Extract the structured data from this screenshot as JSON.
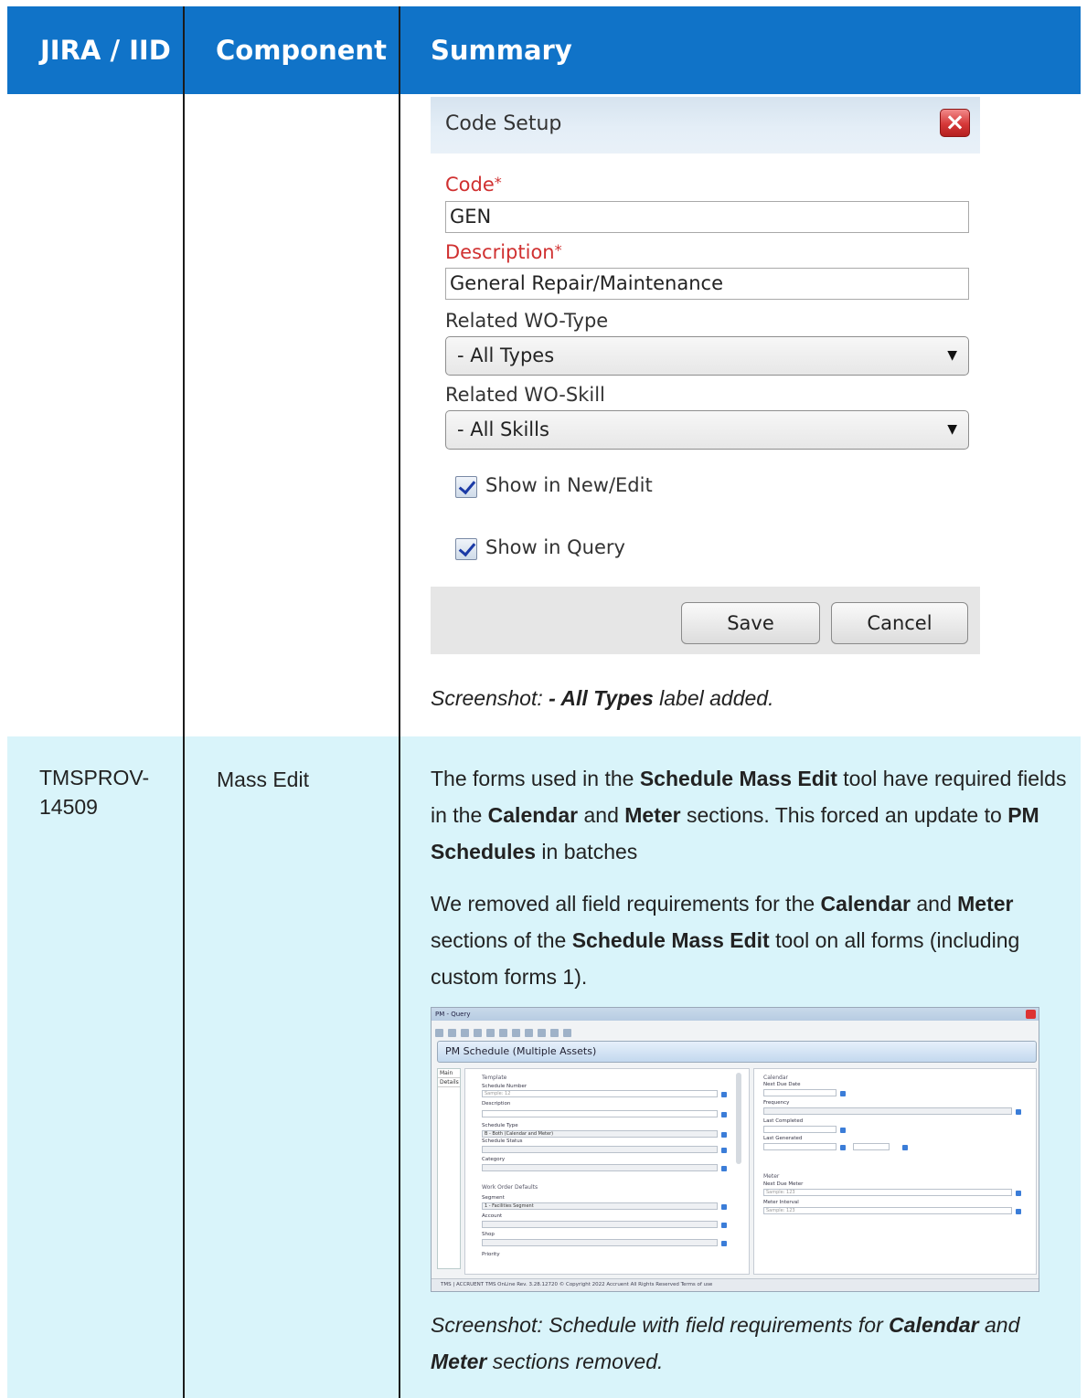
{
  "table": {
    "headers": [
      "JIRA / IID",
      "Component",
      "Summary"
    ]
  },
  "code_setup": {
    "title": "Code Setup",
    "close_symbol": "×",
    "code_label": "Code",
    "required_mark": "*",
    "code_value": "GEN",
    "description_label": "Description",
    "description_value": "General Repair/Maintenance",
    "wo_type_label": "Related WO-Type",
    "wo_type_value": "- All Types",
    "wo_skill_label": "Related WO-Skill",
    "wo_skill_value": "- All Skills",
    "dropdown_arrow": "▼",
    "show_new_edit": {
      "label": "Show in New/Edit",
      "checked": true
    },
    "show_query": {
      "label": "Show in Query",
      "checked": true
    },
    "save_label": "Save",
    "cancel_label": "Cancel"
  },
  "caption1": {
    "prefix": "Screenshot: ",
    "bold": "- All Types",
    "suffix": " label added."
  },
  "row2": {
    "jira": "TMSPROV-14509",
    "jira_line1": "TMSPROV-",
    "jira_line2": "14509",
    "component": "Mass Edit",
    "para1": [
      {
        "t": "The forms used in the "
      },
      {
        "b": "Schedule Mass Edit"
      },
      {
        "t": " tool have required fields in the "
      },
      {
        "b": "Calendar"
      },
      {
        "t": " and "
      },
      {
        "b": "Meter"
      },
      {
        "t": " sections. This forced an update to "
      },
      {
        "b": "PM Schedules"
      },
      {
        "t": " in batches"
      }
    ],
    "para2": [
      {
        "t": "We removed all field requirements for the "
      },
      {
        "b": "Calendar"
      },
      {
        "t": " and "
      },
      {
        "b": "Meter"
      },
      {
        "t": " sections of the "
      },
      {
        "b": "Schedule Mass Edit"
      },
      {
        "t": " tool on all forms (including custom forms 1)."
      }
    ],
    "caption": [
      {
        "t": "Screenshot: Schedule with field requirements for "
      },
      {
        "b": "Calendar"
      },
      {
        "t": " and "
      },
      {
        "b": "Meter"
      },
      {
        "t": " sections removed."
      }
    ]
  },
  "pm_query": {
    "window_title": "PM - Query",
    "header": "PM Schedule (Multiple Assets)",
    "tabs": [
      "Main",
      "Details"
    ],
    "template_section": "Template",
    "schedule_number_label": "Schedule Number",
    "schedule_number_placeholder": "Sample: 12",
    "description_label": "Description",
    "schedule_type_label": "Schedule Type",
    "schedule_type_value": "B - Both (Calendar and Meter)",
    "schedule_status_label": "Schedule Status",
    "category_label": "Category",
    "wo_defaults_section": "Work Order Defaults",
    "segment_label": "Segment",
    "segment_value": "1 - Facilities Segment",
    "account_label": "Account",
    "shop_label": "Shop",
    "priority_label": "Priority",
    "calendar_section": "Calendar",
    "next_due_date_label": "Next Due Date",
    "frequency_label": "Frequency",
    "last_completed_label": "Last Completed",
    "last_generated_label": "Last Generated",
    "meter_section": "Meter",
    "next_due_meter_label": "Next Due Meter",
    "next_due_meter_placeholder": "Sample: 123",
    "meter_interval_label": "Meter Interval",
    "meter_interval_placeholder": "Sample: 123",
    "footer_text": "TMS  |  ACCRUENT  TMS OnLine Rev. 3.28.12720  © Copyright 2022 Accruent All Rights Reserved   Terms of use"
  }
}
